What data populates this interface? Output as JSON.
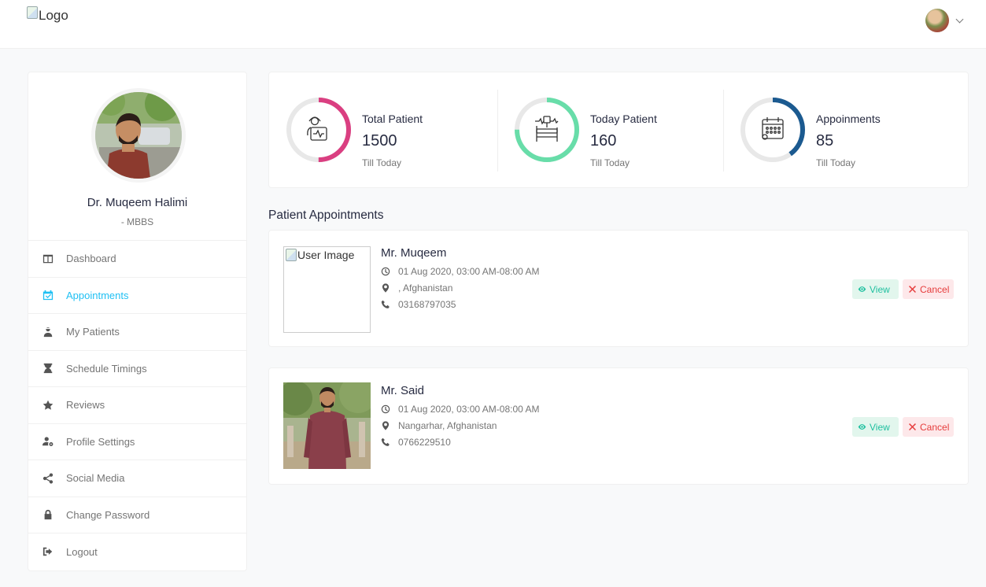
{
  "header": {
    "logo_alt": "Logo"
  },
  "sidebar": {
    "doctor_name": "Dr. Muqeem Halimi",
    "doctor_degree": "- MBBS",
    "items": [
      {
        "label": "Dashboard",
        "icon": "columns-icon",
        "active": false
      },
      {
        "label": "Appointments",
        "icon": "calendar-check-icon",
        "active": true
      },
      {
        "label": "My Patients",
        "icon": "user-injured-icon",
        "active": false
      },
      {
        "label": "Schedule Timings",
        "icon": "hourglass-icon",
        "active": false
      },
      {
        "label": "Reviews",
        "icon": "star-icon",
        "active": false
      },
      {
        "label": "Profile Settings",
        "icon": "user-cog-icon",
        "active": false
      },
      {
        "label": "Social Media",
        "icon": "share-icon",
        "active": false
      },
      {
        "label": "Change Password",
        "icon": "lock-icon",
        "active": false
      },
      {
        "label": "Logout",
        "icon": "sign-out-icon",
        "active": false
      }
    ]
  },
  "stats": [
    {
      "title": "Total Patient",
      "value": "1500",
      "sub": "Till Today",
      "color": "#da3f81",
      "progress": 0.5,
      "icon": "patient-icon"
    },
    {
      "title": "Today Patient",
      "value": "160",
      "sub": "Till Today",
      "color": "#68dda9",
      "progress": 0.75,
      "icon": "hospital-bed-icon"
    },
    {
      "title": "Appoinments",
      "value": "85",
      "sub": "Till Today",
      "color": "#1b5a90",
      "progress": 0.4,
      "icon": "calendar-icon"
    }
  ],
  "section_title": "Patient Appointments",
  "appointments": [
    {
      "name": "Mr. Muqeem",
      "datetime": "01 Aug 2020, 03:00 AM-08:00 AM",
      "location": ", Afghanistan",
      "phone": "03168797035",
      "image_alt": "User Image"
    },
    {
      "name": "Mr. Said",
      "datetime": "01 Aug 2020, 03:00 AM-08:00 AM",
      "location": "Nangarhar, Afghanistan",
      "phone": "0766229510",
      "image_alt": ""
    }
  ],
  "buttons": {
    "view": "View",
    "cancel": "Cancel"
  },
  "colors": {
    "accent": "#20c0f3",
    "view_bg": "#e2f6ed",
    "cancel_bg": "#fde8ea",
    "cancel_text": "#e63c3c"
  }
}
